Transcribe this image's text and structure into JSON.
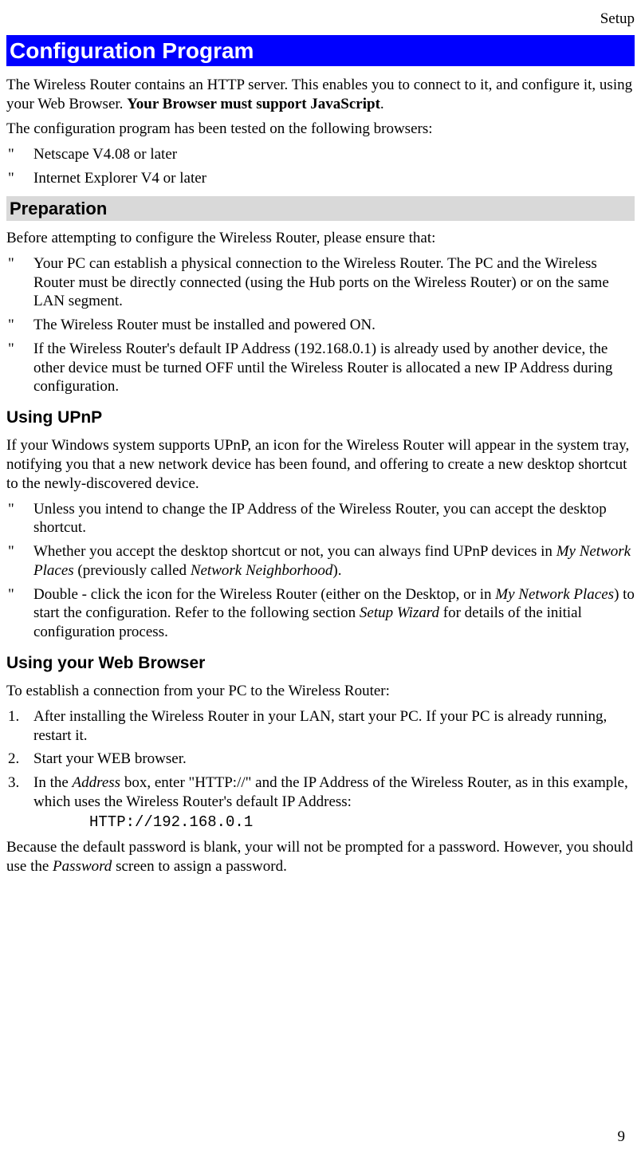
{
  "header": {
    "section": "Setup"
  },
  "title": "Configuration Program",
  "intro": {
    "p1a": "The Wireless Router contains an HTTP server. This enables you to connect to it, and configure it, using your Web Browser. ",
    "p1b": "Your Browser must support JavaScript",
    "p1c": ".",
    "p2": "The configuration program has been tested on the following browsers:",
    "browsers": [
      "Netscape V4.08 or later",
      "Internet Explorer V4 or later"
    ]
  },
  "prep": {
    "heading": "Preparation",
    "lead": "Before attempting to configure the Wireless Router, please ensure that:",
    "items": [
      "Your PC can establish a physical connection to the Wireless Router. The PC and the Wireless Router must be directly connected (using the Hub ports on the Wireless Router) or on the same LAN segment.",
      "The Wireless Router must be installed and powered ON.",
      "If the Wireless Router's default IP Address (192.168.0.1) is already used by another device, the other device must be turned OFF until the Wireless Router is allocated a new IP Address during configuration."
    ]
  },
  "upnp": {
    "heading": "Using UPnP",
    "lead": "If your Windows system supports UPnP, an icon for the Wireless Router will appear in the system tray, notifying you that a new network device has been found, and offering to create a new desktop shortcut to the newly-discovered device.",
    "items": {
      "i0": "Unless you intend to change the IP Address of the Wireless Router, you can accept the desktop shortcut.",
      "i1a": "Whether you accept the desktop shortcut or not, you can always find UPnP devices in ",
      "i1b": "My Network Places",
      "i1c": " (previously called ",
      "i1d": "Network Neighborhood",
      "i1e": ").",
      "i2a": "Double - click the icon for the Wireless Router (either on the Desktop, or in ",
      "i2b": "My Network Places",
      "i2c": ") to start the configuration. Refer to the following section ",
      "i2d": "Setup Wizard",
      "i2e": " for details of the initial configuration process."
    }
  },
  "web": {
    "heading": "Using your Web Browser",
    "lead": "To establish a connection from your PC to the Wireless Router:",
    "steps": {
      "s1": "After installing the Wireless Router in your LAN, start your PC. If your PC is already running, restart it.",
      "s2": "Start your WEB browser.",
      "s3a": "In the ",
      "s3b": "Address",
      "s3c": " box, enter \"HTTP://\" and the IP Address of the Wireless Router, as in this example, which uses the Wireless Router's default IP Address:",
      "s3code": "HTTP://192.168.0.1"
    },
    "tail_a": "Because the default password is blank, your will not be prompted for a password. However, you should use the ",
    "tail_b": "Password",
    "tail_c": " screen to assign a password."
  },
  "page_number": "9"
}
